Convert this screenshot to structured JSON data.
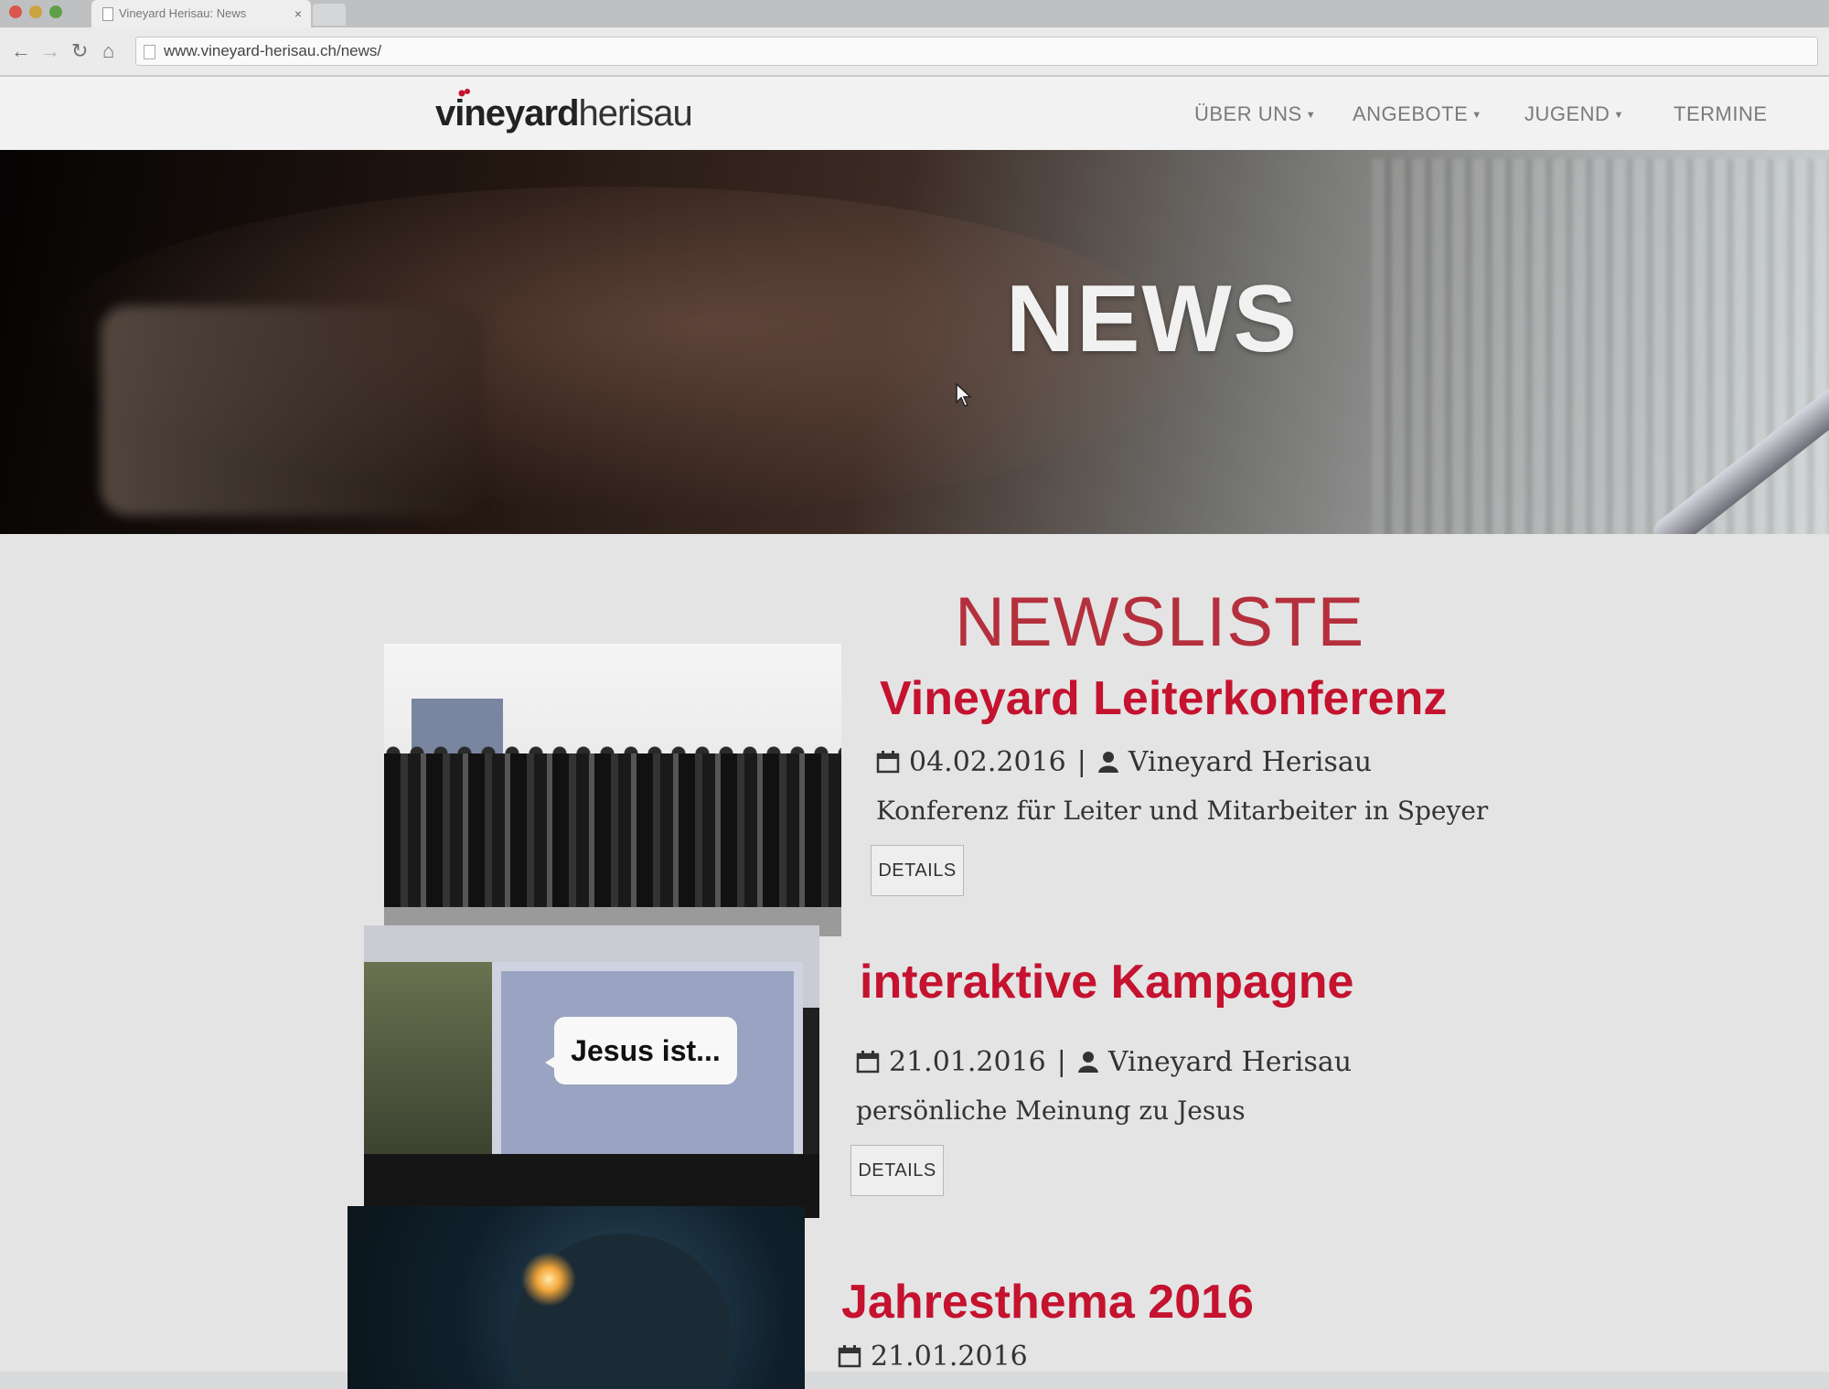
{
  "browser": {
    "tab_title": "Vineyard Herisau: News",
    "tab_close": "×",
    "url": "www.vineyard-herisau.ch/news/"
  },
  "site": {
    "logo_bold": "vineyard",
    "logo_light": "herisau",
    "nav": [
      {
        "label": "ÜBER UNS",
        "has_dropdown": true
      },
      {
        "label": "ANGEBOTE",
        "has_dropdown": true
      },
      {
        "label": "JUGEND",
        "has_dropdown": true
      },
      {
        "label": "TERMINE",
        "has_dropdown": false
      }
    ],
    "accent_color": "#c4122f"
  },
  "hero": {
    "title": "NEWS"
  },
  "news": {
    "section_title": "NEWSLISTE",
    "items": [
      {
        "title": "Vineyard Leiterkonferenz",
        "date": "04.02.2016",
        "author": "Vineyard Herisau",
        "description": "Konferenz für Leiter und Mitarbeiter in Speyer",
        "button": "DETAILS"
      },
      {
        "title": "interaktive Kampagne",
        "date": "21.01.2016",
        "author": "Vineyard Herisau",
        "description": "persönliche Meinung zu Jesus",
        "button": "DETAILS",
        "image_text": "Jesus ist..."
      },
      {
        "title": "Jahresthema 2016",
        "date": "21.01.2016"
      }
    ]
  }
}
